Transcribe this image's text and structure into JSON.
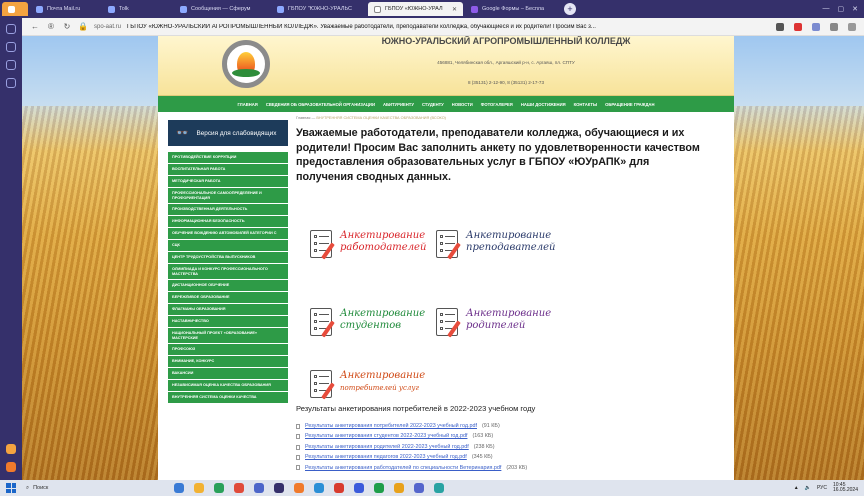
{
  "browser": {
    "tabs": [
      {
        "label": "Почта Mail.ru"
      },
      {
        "label": "Tolk"
      },
      {
        "label": "Сообщения — Сферум"
      },
      {
        "label": "ГБПОУ \"ЮЖНО-УРАЛЬС"
      },
      {
        "label": "ГБПОУ «ЮЖНО-УРАЛ",
        "active": true
      },
      {
        "label": "Google Формы – Беспла"
      }
    ],
    "url_domain": "spo-aat.ru",
    "url_title": "ГБПОУ «ЮЖНО-УРАЛЬСКИЙ АГРОПРОМЫШЛЕННЫЙ КОЛЛЕДЖ». Уважаемые работодатели, преподаватели колледжа, обучающиеся и их родители! Просим Вас з..."
  },
  "site": {
    "college_name": "ЮЖНО-УРАЛЬСКИЙ АГРОПРОМЫШЛЕННЫЙ КОЛЛЕДЖ",
    "address": "456881, Челябинская обл., Аргаяшский р-н, с. Аргаяш, пл. СПТУ",
    "phones": "8 (35131) 2-12-90, 8 (35131) 2-17-73",
    "menu": [
      "ГЛАВНАЯ",
      "СВЕДЕНИЯ ОБ ОБРАЗОВАТЕЛЬНОЙ ОРГАНИЗАЦИИ",
      "АБИТУРИЕНТУ",
      "СТУДЕНТУ",
      "НОВОСТИ",
      "ФОТОГАЛЕРЕЯ",
      "НАШИ ДОСТИЖЕНИЯ",
      "КОНТАКТЫ",
      "ОБРАЩЕНИЕ ГРАЖДАН"
    ],
    "a11y_label": "Версия для слабовидящих",
    "sidenav": [
      "ПРОТИВОДЕЙСТВИЕ КОРРУПЦИИ",
      "ВОСПИТАТЕЛЬНАЯ РАБОТА",
      "МЕТОДИЧЕСКАЯ РАБОТА",
      "ПРОФЕССИОНАЛЬНОЕ САМООПРЕДЕЛЕНИЕ И ПРОФОРИЕНТАЦИЯ",
      "ПРОИЗВОДСТВЕННАЯ ДЕЯТЕЛЬНОСТЬ",
      "ИНФОРМАЦИОННАЯ БЕЗОПАСНОСТЬ",
      "ОБУЧЕНИЕ ВОЖДЕНИЮ АВТОМОБИЛЕЙ КАТЕГОРИИ С",
      "СЦК",
      "ЦЕНТР ТРУДОУСТРОЙСТВА ВЫПУСКНИКОВ",
      "ОЛИМПИАДА И КОНКУРС ПРОФЕССИОНАЛЬНОГО МАСТЕРСТВА",
      "ДИСТАНЦИОННОЕ ОБУЧЕНИЕ",
      "БЕРЕЖЛИВОЕ ОБРАЗОВАНИЕ",
      "ФЛАГМАНЫ ОБРАЗОВАНИЯ",
      "НАСТАВНИЧЕСТВО",
      "НАЦИОНАЛЬНЫЙ ПРОЕКТ «ОБРАЗОВАНИЕ» МАСТЕРСКИЕ",
      "ПРОФСОЮЗ",
      "ВНИМАНИЕ, КОНКУРС",
      "ВАКАНСИИ",
      "НЕЗАВИСИМАЯ ОЦЕНКА КАЧЕСТВА ОБРАЗОВАНИЯ",
      "ВНУТРЕННЯЯ СИСТЕМА ОЦЕНКИ КАЧЕСТВА"
    ],
    "breadcrumb_home": "Главная",
    "breadcrumb_sep": "—",
    "breadcrumb_current": "ВНУТРЕННЯЯ СИСТЕМА ОЦЕНКИ КАЧЕСТВА ОБРАЗОВАНИЯ (ВСОКО)",
    "heading": "Уважаемые работодатели, преподаватели колледжа, обучающиеся и их родители! Просим Вас заполнить анкету по удовлетворенности качеством предоставления образовательных услуг в ГБПОУ «ЮУрАПК» для получения сводных данных.",
    "tiles": [
      {
        "line1": "Анкетирование",
        "line2": "работодателей",
        "color": "#d9262b"
      },
      {
        "line1": "Анкетирование",
        "line2": "преподавателей",
        "color": "#2a3a6a"
      },
      {
        "line1": "Анкетирование",
        "line2": "студентов",
        "color": "#1f8a3a"
      },
      {
        "line1": "Анкетирование",
        "line2": "родителей",
        "color": "#6b2e8a"
      },
      {
        "line1": "Анкетирование",
        "line2": "потребителей услуг",
        "color": "#d04a16"
      }
    ],
    "results_title": "Результаты анкетирования потребителей в 2022-2023 учебном году",
    "results": [
      {
        "label": "Результаты анкетирования потребителей 2022-2023 учебный год.pdf",
        "size": "(91 КБ)"
      },
      {
        "label": "Результаты анкетирования студентов 2022-2023 учебный год.pdf",
        "size": "(163 КБ)"
      },
      {
        "label": "Результаты анкетирования родителей 2022-2023 учебный год.pdf",
        "size": "(238 КБ)"
      },
      {
        "label": "Результаты анкетирования педагогов 2022-2023 учебный год.pdf",
        "size": "(345 КБ)"
      },
      {
        "label": "Результаты анкетирования работодателей по специальности Ветеринария.pdf",
        "size": "(203 КБ)"
      }
    ]
  },
  "taskbar": {
    "search": "Поиск",
    "lang": "РУС",
    "time": "10:45",
    "date": "16.05.2024"
  },
  "colors": {
    "menu_green": "#2e9b47",
    "a11y_navy": "#1d3b5a",
    "link_blue": "#3a5fc8"
  }
}
